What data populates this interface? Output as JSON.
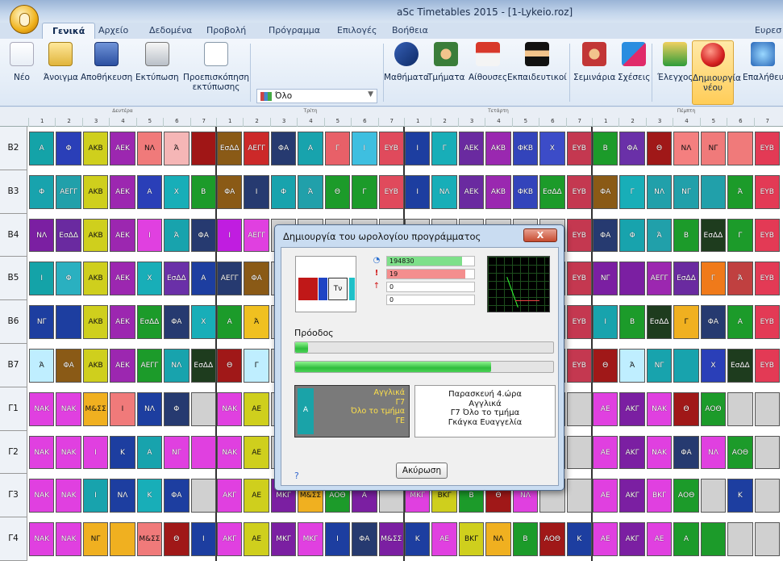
{
  "window": {
    "title": "aSc Timetables 2015  -  [1-Lykeio.roz]"
  },
  "ribbon_tabs": [
    {
      "label": "Γενικά",
      "active": true
    },
    {
      "label": "Αρχείο"
    },
    {
      "label": "Δεδομένα"
    },
    {
      "label": "Προβολή"
    },
    {
      "label": "Πρόγραμμα"
    },
    {
      "label": "Επιλογές"
    },
    {
      "label": "Βοήθεια"
    },
    {
      "label": "Ευρεσ"
    }
  ],
  "toolbar": {
    "new": "Νέο",
    "open": "Άνοιγμα",
    "save": "Αποθήκευση",
    "print": "Εκτύπωση",
    "preview": "Προεπισκόπηση",
    "preview2": "εκτύπωσης",
    "class_select_value": "Όλο",
    "subjects": "Μαθήματα",
    "classes": "Τμήματα",
    "rooms": "Αίθουσες",
    "teachers": "Εκπαιδευτικοί",
    "seminars": "Σεμινάρια",
    "relations": "Σχέσεις",
    "check": "Έλεγχος",
    "generate": "Δημιουργία",
    "generate2": "νέου",
    "verify": "Επαλήθευ"
  },
  "days": [
    "Δευτέρα",
    "Τρίτη",
    "Τετάρτη",
    "Πέμπτη"
  ],
  "periods": [
    "1",
    "2",
    "3",
    "4",
    "5",
    "6",
    "7"
  ],
  "rows": [
    "B2",
    "B3",
    "B4",
    "B5",
    "B6",
    "B7",
    "Γ1",
    "Γ2",
    "Γ3",
    "Γ4"
  ],
  "cells": {
    "B2": [
      [
        "Α",
        "#14a3a8"
      ],
      [
        "Φ",
        "#2a3fb8"
      ],
      [
        "ΑΚΒ",
        "#cfcf1d"
      ],
      [
        "ΑΕΚ",
        "#9c27b0"
      ],
      [
        "ΝΛ",
        "#f07a7a"
      ],
      [
        "Ά",
        "#f5b6b6"
      ],
      [
        "",
        "#a01616"
      ],
      [
        "ΕσΔΔ",
        "#8a5a16"
      ],
      [
        "ΑΕΓΓ",
        "#cc2929"
      ],
      [
        "ΦΑ",
        "#263a70"
      ],
      [
        "Α",
        "#18a3ad"
      ],
      [
        "Γ",
        "#e86068"
      ],
      [
        "Ι",
        "#3ebfe0"
      ],
      [
        "ΕΥΒ",
        "#e04a5c"
      ],
      [
        "Ι",
        "#1d3ea0"
      ],
      [
        "Γ",
        "#18aeb8"
      ],
      [
        "ΑΕΚ",
        "#6a2aa0"
      ],
      [
        "ΑΚΒ",
        "#9a28b0"
      ],
      [
        "ΦΚΒ",
        "#3344bb"
      ],
      [
        "Χ",
        "#3c4cc8"
      ],
      [
        "ΕΥΒ",
        "#c43850"
      ],
      [
        "Β",
        "#1c9b2a"
      ],
      [
        "ΦΑ",
        "#6a30a8"
      ],
      [
        "Θ",
        "#a01818"
      ],
      [
        "ΝΛ",
        "#f47f7f"
      ],
      [
        "ΝΓ",
        "#f07a7a"
      ],
      [
        "",
        "#f07a7a"
      ],
      [
        "ΕΥΒ",
        "#e33a55"
      ]
    ],
    "B3": [
      [
        "Φ",
        "#18a3ad"
      ],
      [
        "ΑΕΓΓ",
        "#21a0aa"
      ],
      [
        "ΑΚΒ",
        "#cfcf1d"
      ],
      [
        "ΑΕΚ",
        "#9c27b0"
      ],
      [
        "Α",
        "#2a3fb8"
      ],
      [
        "Χ",
        "#18aeb8"
      ],
      [
        "Β",
        "#1c9b2a"
      ],
      [
        "ΦΑ",
        "#8a5a16"
      ],
      [
        "Ι",
        "#263a70"
      ],
      [
        "Φ",
        "#18a3ad"
      ],
      [
        "Ά",
        "#21a0aa"
      ],
      [
        "Θ",
        "#1c9b2a"
      ],
      [
        "Γ",
        "#1c9b2a"
      ],
      [
        "ΕΥΒ",
        "#e04a5c"
      ],
      [
        "Ι",
        "#1d3ea0"
      ],
      [
        "ΝΛ",
        "#18aeb8"
      ],
      [
        "ΑΕΚ",
        "#6a2aa0"
      ],
      [
        "ΑΚΒ",
        "#9a28b0"
      ],
      [
        "ΦΚΒ",
        "#3344bb"
      ],
      [
        "ΕσΔΔ",
        "#1c9b2a"
      ],
      [
        "ΕΥΒ",
        "#c43850"
      ],
      [
        "ΦΑ",
        "#8a5a16"
      ],
      [
        "Γ",
        "#18aeb8"
      ],
      [
        "ΝΛ",
        "#21a0aa"
      ],
      [
        "ΝΓ",
        "#21a0aa"
      ],
      [
        "",
        "#21a0aa"
      ],
      [
        "Ά",
        "#1c9b2a"
      ],
      [
        "ΕΥΒ",
        "#e33a55"
      ]
    ],
    "B4": [
      [
        "ΝΛ",
        "#7b1fa2"
      ],
      [
        "ΕσΔΔ",
        "#6a2aa0"
      ],
      [
        "ΑΚΒ",
        "#cfcf1d"
      ],
      [
        "ΑΕΚ",
        "#9c27b0"
      ],
      [
        "Ι",
        "#e040e0"
      ],
      [
        "Ά",
        "#18a3ad"
      ],
      [
        "ΦΑ",
        "#263a70"
      ],
      [
        "Ι",
        "#c01de0"
      ],
      [
        "ΑΕΓΓ",
        "#e040e0"
      ],
      [
        "",
        "#d0d0d0"
      ],
      [
        "",
        "#d0d0d0"
      ],
      [
        "",
        "#d0d0d0"
      ],
      [
        "",
        "#d0d0d0"
      ],
      [
        "",
        "#d0d0d0"
      ],
      [
        "",
        "#d0d0d0"
      ],
      [
        "",
        "#d0d0d0"
      ],
      [
        "",
        "#d0d0d0"
      ],
      [
        "",
        "#d0d0d0"
      ],
      [
        "",
        "#d0d0d0"
      ],
      [
        "",
        "#d0d0d0"
      ],
      [
        "ΕΥΒ",
        "#c43850"
      ],
      [
        "ΦΑ",
        "#263a70"
      ],
      [
        "Φ",
        "#18a3ad"
      ],
      [
        "Ά",
        "#21a0aa"
      ],
      [
        "Β",
        "#1c9b2a"
      ],
      [
        "ΕσΔΔ",
        "#1e3c1e"
      ],
      [
        "Γ",
        "#1c9b2a"
      ],
      [
        "ΕΥΒ",
        "#e33a55"
      ]
    ],
    "B5": [
      [
        "Ι",
        "#14a3a8"
      ],
      [
        "Φ",
        "#2ab0c0"
      ],
      [
        "ΑΚΒ",
        "#cfcf1d"
      ],
      [
        "ΑΕΚ",
        "#9c27b0"
      ],
      [
        "Χ",
        "#18aeb8"
      ],
      [
        "ΕσΔΔ",
        "#6a30a8"
      ],
      [
        "Α",
        "#1d3ea0"
      ],
      [
        "ΑΕΓΓ",
        "#263a70"
      ],
      [
        "ΦΑ",
        "#8a5a16"
      ],
      [
        "",
        "#d0d0d0"
      ],
      [
        "",
        "#d0d0d0"
      ],
      [
        "",
        "#d0d0d0"
      ],
      [
        "",
        "#d0d0d0"
      ],
      [
        "",
        "#d0d0d0"
      ],
      [
        "",
        "#d0d0d0"
      ],
      [
        "",
        "#d0d0d0"
      ],
      [
        "",
        "#d0d0d0"
      ],
      [
        "",
        "#d0d0d0"
      ],
      [
        "",
        "#d0d0d0"
      ],
      [
        "",
        "#d0d0d0"
      ],
      [
        "ΕΥΒ",
        "#c43850"
      ],
      [
        "ΝΓ",
        "#7b1fa2"
      ],
      [
        "",
        "#7b1fa2"
      ],
      [
        "ΑΕΓΓ",
        "#9c27b0"
      ],
      [
        "ΕσΔΔ",
        "#6a2aa0"
      ],
      [
        "Γ",
        "#f07a1a"
      ],
      [
        "Ά",
        "#c04040"
      ],
      [
        "ΕΥΒ",
        "#e33a55"
      ]
    ],
    "B6": [
      [
        "ΝΓ",
        "#1d3ea0"
      ],
      [
        "",
        "#1d3ea0"
      ],
      [
        "ΑΚΒ",
        "#cfcf1d"
      ],
      [
        "ΑΕΚ",
        "#9c27b0"
      ],
      [
        "ΕσΔΔ",
        "#1c9b2a"
      ],
      [
        "ΦΑ",
        "#263a70"
      ],
      [
        "Χ",
        "#18aeb8"
      ],
      [
        "Α",
        "#1c9b2a"
      ],
      [
        "Ά",
        "#f0c020"
      ],
      [
        "",
        "#d0d0d0"
      ],
      [
        "",
        "#d0d0d0"
      ],
      [
        "",
        "#d0d0d0"
      ],
      [
        "",
        "#d0d0d0"
      ],
      [
        "",
        "#d0d0d0"
      ],
      [
        "",
        "#d0d0d0"
      ],
      [
        "",
        "#d0d0d0"
      ],
      [
        "",
        "#d0d0d0"
      ],
      [
        "",
        "#d0d0d0"
      ],
      [
        "",
        "#d0d0d0"
      ],
      [
        "",
        "#d0d0d0"
      ],
      [
        "ΕΥΒ",
        "#c43850"
      ],
      [
        "Ι",
        "#18a3ad"
      ],
      [
        "Β",
        "#1c9b2a"
      ],
      [
        "ΕσΔΔ",
        "#1e3c1e"
      ],
      [
        "Γ",
        "#f0b020"
      ],
      [
        "ΦΑ",
        "#263a70"
      ],
      [
        "Α",
        "#1c9b2a"
      ],
      [
        "ΕΥΒ",
        "#e33a55"
      ]
    ],
    "B7": [
      [
        "Ά",
        "#bfeeff"
      ],
      [
        "ΦΑ",
        "#8a5a16"
      ],
      [
        "ΑΚΒ",
        "#cfcf1d"
      ],
      [
        "ΑΕΚ",
        "#9c27b0"
      ],
      [
        "ΑΕΓΓ",
        "#1c9b2a"
      ],
      [
        "ΝΛ",
        "#18a3ad"
      ],
      [
        "ΕσΔΔ",
        "#1e3c1e"
      ],
      [
        "Θ",
        "#a01818"
      ],
      [
        "Γ",
        "#bfeeff"
      ],
      [
        "",
        "#d0d0d0"
      ],
      [
        "",
        "#d0d0d0"
      ],
      [
        "",
        "#d0d0d0"
      ],
      [
        "",
        "#d0d0d0"
      ],
      [
        "",
        "#d0d0d0"
      ],
      [
        "",
        "#d0d0d0"
      ],
      [
        "",
        "#d0d0d0"
      ],
      [
        "",
        "#d0d0d0"
      ],
      [
        "",
        "#d0d0d0"
      ],
      [
        "",
        "#d0d0d0"
      ],
      [
        "",
        "#d0d0d0"
      ],
      [
        "ΕΥΒ",
        "#c43850"
      ],
      [
        "Θ",
        "#a01818"
      ],
      [
        "Ά",
        "#bfeeff"
      ],
      [
        "ΝΓ",
        "#18a3ad"
      ],
      [
        "",
        "#18a3ad"
      ],
      [
        "Χ",
        "#2a3fb8"
      ],
      [
        "ΕσΔΔ",
        "#1e3c1e"
      ],
      [
        "ΕΥΒ",
        "#e33a55"
      ]
    ],
    "Γ1": [
      [
        "ΝΑΚ",
        "#e040e0"
      ],
      [
        "ΝΑΚ",
        "#e040e0"
      ],
      [
        "Μ&ΣΣ",
        "#f0b020"
      ],
      [
        "Ι",
        "#f07a7a"
      ],
      [
        "ΝΛ",
        "#1d3ea0"
      ],
      [
        "Φ",
        "#263a70"
      ],
      [
        "",
        "#d0d0d0"
      ],
      [
        "ΝΑΚ",
        "#e040e0"
      ],
      [
        "ΑΕ",
        "#cfcf1d"
      ],
      [
        "",
        "#d0d0d0"
      ],
      [
        "",
        "#d0d0d0"
      ],
      [
        "",
        "#d0d0d0"
      ],
      [
        "",
        "#d0d0d0"
      ],
      [
        "",
        "#d0d0d0"
      ],
      [
        "",
        "#d0d0d0"
      ],
      [
        "",
        "#d0d0d0"
      ],
      [
        "",
        "#d0d0d0"
      ],
      [
        "",
        "#d0d0d0"
      ],
      [
        "",
        "#d0d0d0"
      ],
      [
        "",
        "#d0d0d0"
      ],
      [
        "",
        "#d0d0d0"
      ],
      [
        "ΑΕ",
        "#e040e0"
      ],
      [
        "ΑΚΓ",
        "#7b1fa2"
      ],
      [
        "ΝΑΚ",
        "#e040e0"
      ],
      [
        "Θ",
        "#a01818"
      ],
      [
        "ΑΟΘ",
        "#1c9b2a"
      ],
      [
        "",
        "#d0d0d0"
      ],
      [
        "",
        "#d0d0d0"
      ]
    ],
    "Γ2": [
      [
        "ΝΑΚ",
        "#e040e0"
      ],
      [
        "ΝΑΚ",
        "#e040e0"
      ],
      [
        "Ι",
        "#e040e0"
      ],
      [
        "Κ",
        "#1d3ea0"
      ],
      [
        "Α",
        "#18a3ad"
      ],
      [
        "ΝΓ",
        "#e040e0"
      ],
      [
        "",
        "#e040e0"
      ],
      [
        "ΝΑΚ",
        "#e040e0"
      ],
      [
        "ΑΕ",
        "#cfcf1d"
      ],
      [
        "",
        "#d0d0d0"
      ],
      [
        "",
        "#d0d0d0"
      ],
      [
        "",
        "#d0d0d0"
      ],
      [
        "",
        "#d0d0d0"
      ],
      [
        "",
        "#d0d0d0"
      ],
      [
        "",
        "#d0d0d0"
      ],
      [
        "",
        "#d0d0d0"
      ],
      [
        "",
        "#d0d0d0"
      ],
      [
        "",
        "#d0d0d0"
      ],
      [
        "",
        "#d0d0d0"
      ],
      [
        "",
        "#d0d0d0"
      ],
      [
        "",
        "#d0d0d0"
      ],
      [
        "ΑΕ",
        "#e040e0"
      ],
      [
        "ΑΚΓ",
        "#7b1fa2"
      ],
      [
        "ΝΑΚ",
        "#e040e0"
      ],
      [
        "ΦΑ",
        "#263a70"
      ],
      [
        "ΝΛ",
        "#e040e0"
      ],
      [
        "ΑΟΘ",
        "#1c9b2a"
      ],
      [
        "",
        "#d0d0d0"
      ]
    ],
    "Γ3": [
      [
        "ΝΑΚ",
        "#e040e0"
      ],
      [
        "ΝΑΚ",
        "#e040e0"
      ],
      [
        "Ι",
        "#18a3ad"
      ],
      [
        "ΝΛ",
        "#1d3ea0"
      ],
      [
        "Κ",
        "#18aeb8"
      ],
      [
        "ΦΑ",
        "#1d3ea0"
      ],
      [
        "",
        "#d0d0d0"
      ],
      [
        "ΑΚΓ",
        "#e040e0"
      ],
      [
        "ΑΕ",
        "#cfcf1d"
      ],
      [
        "ΜΚΓ",
        "#7b1fa2"
      ],
      [
        "Μ&ΣΣ",
        "#f0b020"
      ],
      [
        "ΑΟΘ",
        "#1c9b2a"
      ],
      [
        "Α",
        "#7b1fa2"
      ],
      [
        "",
        "#d0d0d0"
      ],
      [
        "ΜΚΓ",
        "#e040e0"
      ],
      [
        "ΒΚΓ",
        "#cfcf1d"
      ],
      [
        "Β",
        "#1c9b2a"
      ],
      [
        "Θ",
        "#a01818"
      ],
      [
        "ΝΛ",
        "#e040e0"
      ],
      [
        "",
        "#d0d0d0"
      ],
      [
        "",
        "#d0d0d0"
      ],
      [
        "ΑΕ",
        "#e040e0"
      ],
      [
        "ΑΚΓ",
        "#7b1fa2"
      ],
      [
        "ΒΚΓ",
        "#e040e0"
      ],
      [
        "ΑΟΘ",
        "#1c9b2a"
      ],
      [
        "",
        "#d0d0d0"
      ],
      [
        "Κ",
        "#1d3ea0"
      ],
      [
        "",
        "#d0d0d0"
      ]
    ],
    "Γ4": [
      [
        "ΝΑΚ",
        "#e040e0"
      ],
      [
        "ΝΑΚ",
        "#e040e0"
      ],
      [
        "ΝΓ",
        "#f0b020"
      ],
      [
        "",
        "#f0b020"
      ],
      [
        "Μ&ΣΣ",
        "#f07a7a"
      ],
      [
        "Θ",
        "#a01818"
      ],
      [
        "Ι",
        "#1d3ea0"
      ],
      [
        "ΑΚΓ",
        "#e040e0"
      ],
      [
        "ΑΕ",
        "#cfcf1d"
      ],
      [
        "ΜΚΓ",
        "#7b1fa2"
      ],
      [
        "ΜΚΓ",
        "#e040e0"
      ],
      [
        "Ι",
        "#1d3ea0"
      ],
      [
        "ΦΑ",
        "#263a70"
      ],
      [
        "Μ&ΣΣ",
        "#7b1fa2"
      ],
      [
        "Κ",
        "#1d3ea0"
      ],
      [
        "ΑΕ",
        "#e040e0"
      ],
      [
        "ΒΚΓ",
        "#cfcf1d"
      ],
      [
        "ΝΛ",
        "#f0b020"
      ],
      [
        "Β",
        "#1c9b2a"
      ],
      [
        "ΑΟΘ",
        "#a01818"
      ],
      [
        "Κ",
        "#1d3ea0"
      ],
      [
        "ΑΕ",
        "#e040e0"
      ],
      [
        "ΑΚΓ",
        "#7b1fa2"
      ],
      [
        "ΑΕ",
        "#e040e0"
      ],
      [
        "Α",
        "#1c9b2a"
      ],
      [
        "",
        "#1c9b2a"
      ],
      [
        "",
        "#d0d0d0"
      ],
      [
        "",
        "#d0d0d0"
      ]
    ]
  },
  "dialog": {
    "title": "Δημιουργία του ωρολογίου προγράμματος",
    "close": "X",
    "stats": {
      "iterations": "194830",
      "conflicts": "19",
      "placed": "0",
      "other": "0"
    },
    "progress_label": "Πρόοδος",
    "progress_small": 0.05,
    "progress_main": 0.76,
    "preview_label": "Τν",
    "current_block": {
      "letter": "Α",
      "subject": "Αγγλικά",
      "class": "Γ7",
      "group": "Όλο το τμήμα",
      "room": "ΓΕ"
    },
    "current_info": [
      "Παρασκευή 4.ώρα",
      "Αγγλικά",
      "Γ7 Όλο το τμήμα",
      "Γκάγκα Ευαγγελία"
    ],
    "cancel": "Ακύρωση",
    "help": "?"
  }
}
